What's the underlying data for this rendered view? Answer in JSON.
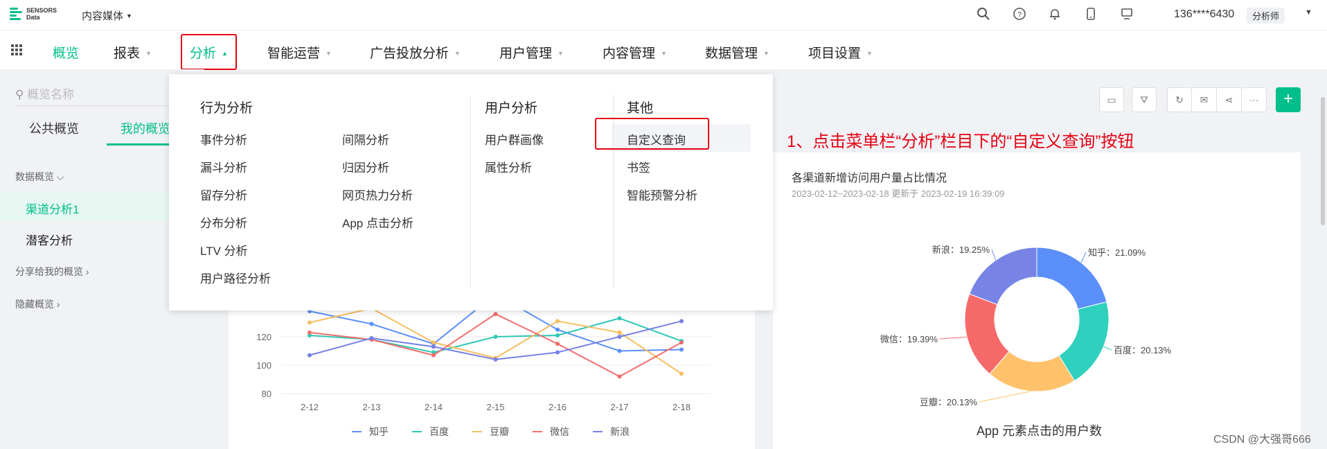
{
  "header": {
    "logo_line1": "SENSORS",
    "logo_line2": "Data",
    "project": "内容媒体",
    "user": "136****6430",
    "role": "分析师"
  },
  "nav": [
    "概览",
    "报表",
    "分析",
    "智能运营",
    "广告投放分析",
    "用户管理",
    "内容管理",
    "数据管理",
    "项目设置"
  ],
  "sidebar": {
    "search_placeholder": "概览名称",
    "tabs": [
      "公共概览",
      "我的概览"
    ],
    "group1": "数据概览",
    "items": [
      "渠道分析1",
      "潜客分析"
    ],
    "group2": "分享给我的概览",
    "group3": "隐藏概览"
  },
  "menu": {
    "col1_title": "行为分析",
    "col1a": [
      "事件分析",
      "漏斗分析",
      "留存分析",
      "分布分析",
      "LTV 分析",
      "用户路径分析"
    ],
    "col1b": [
      "间隔分析",
      "归因分析",
      "网页热力分析",
      "App 点击分析"
    ],
    "col2_title": "用户分析",
    "col2": [
      "用户群画像",
      "属性分析"
    ],
    "col3_title": "其他",
    "col3": [
      "自定义查询",
      "书签",
      "智能预警分析"
    ]
  },
  "annotation": "1、点击菜单栏“分析”栏目下的“自定义查询”按钮",
  "colors": {
    "accent": "#00bf8a",
    "annotation": "#e60012"
  },
  "chart_data": [
    {
      "type": "line",
      "categories": [
        "2-12",
        "2-13",
        "2-14",
        "2-15",
        "2-16",
        "2-17",
        "2-18"
      ],
      "ylim": [
        80,
        140
      ],
      "yticks": [
        80,
        100,
        120,
        140
      ],
      "ytick_labels": [
        "80",
        "100",
        "120"
      ],
      "series": [
        {
          "name": "知乎",
          "color": "#5b8ff9",
          "values": [
            138,
            129,
            115,
            150,
            125,
            110,
            111
          ]
        },
        {
          "name": "百度",
          "color": "#2fc7b5",
          "values": [
            121,
            118,
            109,
            120,
            121,
            133,
            117
          ]
        },
        {
          "name": "豆瓣",
          "color": "#f6bd60",
          "values": [
            130,
            140,
            116,
            105,
            131,
            123,
            94
          ]
        },
        {
          "name": "微信",
          "color": "#f16d6d",
          "values": [
            123,
            118,
            107,
            136,
            115,
            92,
            116
          ]
        },
        {
          "name": "新浪",
          "color": "#7480e6",
          "values": [
            107,
            119,
            113,
            104,
            109,
            120,
            131
          ]
        }
      ]
    },
    {
      "type": "pie",
      "title": "各渠道新增访问用户量占比情况",
      "subtitle": "2023-02-12~2023-02-18 更新于 2023-02-19 16:39:09",
      "slices": [
        {
          "label": "知乎",
          "value": 21.09,
          "text": "知乎：21.09%",
          "color": "#5b8ff9"
        },
        {
          "label": "百度",
          "value": 20.13,
          "text": "百度：20.13%",
          "color": "#2fd0bd"
        },
        {
          "label": "豆瓣",
          "value": 20.13,
          "text": "豆瓣：20.13%",
          "color": "#ffc26b"
        },
        {
          "label": "微信",
          "value": 19.39,
          "text": "微信：19.39%",
          "color": "#f76a6a"
        },
        {
          "label": "新浪",
          "value": 19.25,
          "text": "新浪：19.25%",
          "color": "#7784e6"
        }
      ]
    }
  ],
  "next_chart_title": "App 元素点击的用户数",
  "watermark": "CSDN @大强哥666"
}
